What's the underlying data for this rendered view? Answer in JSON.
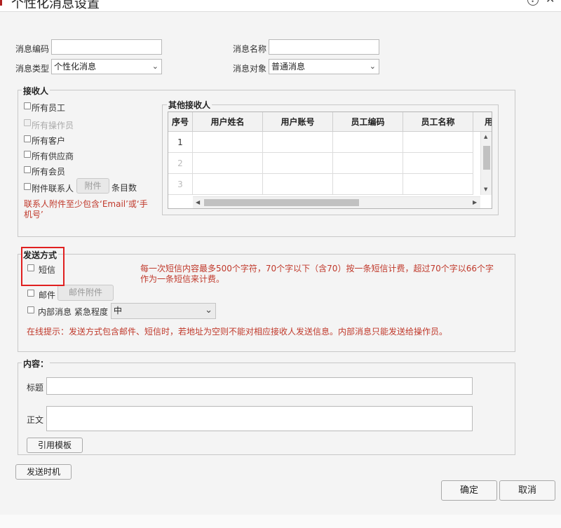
{
  "window": {
    "title": "个性化消息设置"
  },
  "form": {
    "code_label": "消息编码",
    "name_label": "消息名称",
    "type_label": "消息类型",
    "type_value": "个性化消息",
    "target_label": "消息对象",
    "target_value": "普通消息"
  },
  "receivers": {
    "legend": "接收人",
    "items": [
      {
        "label": "所有员工",
        "disabled": false
      },
      {
        "label": "所有操作员",
        "disabled": true
      },
      {
        "label": "所有客户",
        "disabled": false
      },
      {
        "label": "所有供应商",
        "disabled": false
      },
      {
        "label": "所有会员",
        "disabled": false
      }
    ],
    "attach_contact_label": "附件联系人",
    "attach_button": "附件",
    "entries_label": "条目数",
    "note_line1": "联系人附件至少包含‘Email’或‘手",
    "note_line2": "机号’",
    "others": {
      "legend": "其他接收人",
      "columns": [
        "序号",
        "用户姓名",
        "用户账号",
        "员工编码",
        "员工名称",
        "用"
      ],
      "rows": [
        "1",
        "2",
        "3"
      ]
    }
  },
  "send": {
    "legend": "发送方式",
    "sms_label": "短信",
    "sms_note_line1": "每一次短信内容最多500个字符，70个字以下（含70）按一条短信计费，超过70个字以66个字",
    "sms_note_line2": "作为一条短信来计费。",
    "mail_label": "邮件",
    "mail_attach_button": "邮件附件",
    "internal_label": "内部消息",
    "urgency_label": "紧急程度",
    "urgency_value": "中",
    "hint": "在线提示：发送方式包含邮件、短信时，若地址为空则不能对相应接收人发送信息。内部消息只能发送给操作员。"
  },
  "content": {
    "legend": "内容：",
    "title_label": "标题",
    "body_label": "正文",
    "template_button": "引用模板"
  },
  "footer": {
    "timing_button": "发送时机",
    "ok_button": "确定",
    "cancel_button": "取消"
  },
  "colors": {
    "note_red": "#c0392b",
    "highlight": "#e02020"
  }
}
